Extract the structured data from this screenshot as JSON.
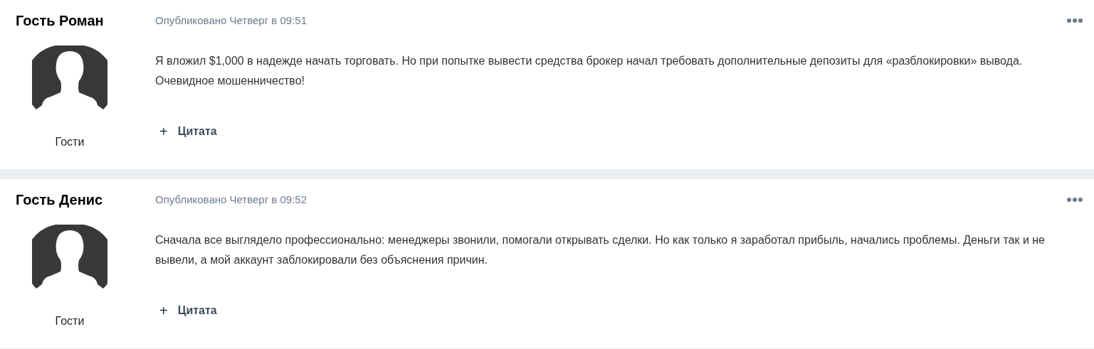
{
  "posts": [
    {
      "author": "Гость Роман",
      "group": "Гости",
      "timestamp": "Опубликовано Четверг в 09:51",
      "body": "Я вложил $1,000 в надежде начать торговать. Но при попытке вывести средства брокер начал требовать дополнительные депозиты для «разблокировки» вывода. Очевидное мошенничество!",
      "quote_label": "Цитата",
      "quote_icon": "+"
    },
    {
      "author": "Гость Денис",
      "group": "Гости",
      "timestamp": "Опубликовано Четверг в 09:52",
      "body": "Сначала все выглядело профессионально: менеджеры звонили, помогали открывать сделки. Но как только я заработал прибыль, начались проблемы. Деньги так и не вывели, а мой аккаунт заблокировали без объяснения причин.",
      "quote_label": "Цитата",
      "quote_icon": "+"
    }
  ]
}
